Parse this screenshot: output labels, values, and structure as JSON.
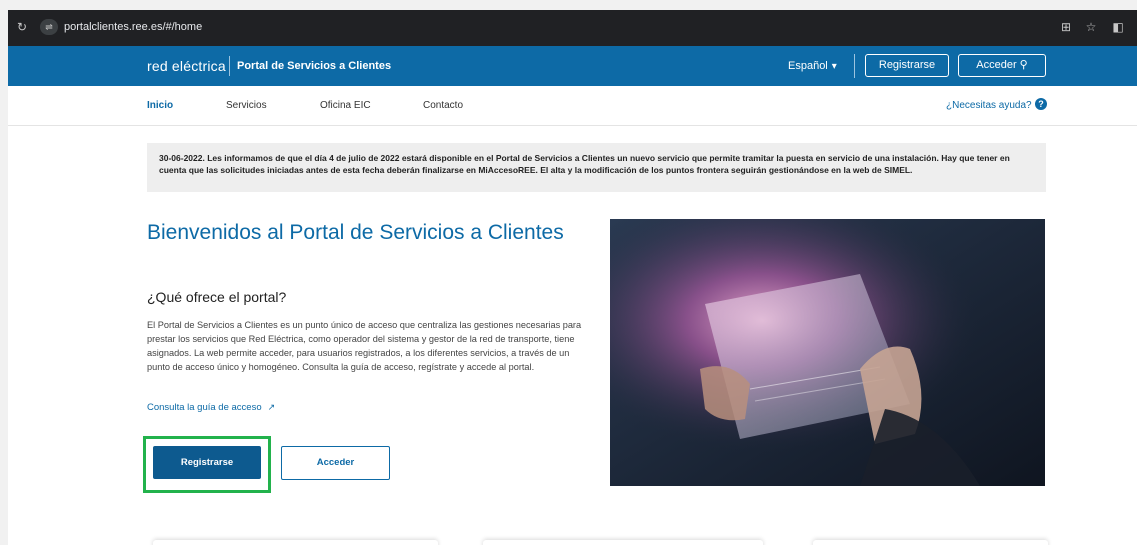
{
  "browser": {
    "url": "portalclientes.ree.es/#/home",
    "reload_icon": "reload-icon",
    "site_info_icon": "site-info-icon"
  },
  "header": {
    "brand": "red eléctrica",
    "portal_title": "Portal de Servicios a Clientes",
    "language": "Español",
    "register_label": "Registrarse",
    "login_label": "Acceder"
  },
  "nav": {
    "items": [
      {
        "label": "Inicio",
        "active": true
      },
      {
        "label": "Servicios",
        "active": false
      },
      {
        "label": "Oficina EIC",
        "active": false
      },
      {
        "label": "Contacto",
        "active": false
      }
    ],
    "help_label": "¿Necesitas ayuda?"
  },
  "notice": {
    "text": "30-06-2022. Les informamos de que el día 4 de julio de 2022 estará disponible en el Portal de Servicios a Clientes un nuevo servicio que permite tramitar la puesta en servicio de una instalación. Hay que tener en cuenta que las solicitudes iniciadas antes de esta fecha deberán finalizarse en MiAccesoREE. El alta y la modificación de los puntos frontera seguirán gestionándose en la web de SIMEL."
  },
  "main": {
    "title": "Bienvenidos al Portal de Servicios a Clientes",
    "subtitle": "¿Qué ofrece el portal?",
    "description": "El Portal de Servicios a Clientes es un punto único de acceso que centraliza las gestiones necesarias para prestar los servicios que Red Eléctrica, como operador del sistema y gestor de la red de transporte, tiene asignados. La web permite acceder, para usuarios registrados, a los diferentes servicios, a través de un punto de acceso único y homogéneo. Consulta la guía de acceso, regístrate y accede al portal.",
    "guide_link": "Consulta la guía de acceso",
    "register_button": "Registrarse",
    "login_button": "Acceder"
  },
  "colors": {
    "brand_blue": "#0d6aa6",
    "button_blue": "#0d5a8f",
    "highlight_green": "#22b24c"
  }
}
